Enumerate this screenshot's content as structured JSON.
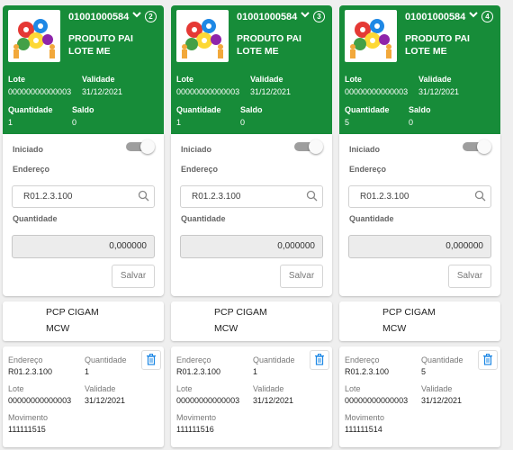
{
  "labels": {
    "lote": "Lote",
    "validade": "Validade",
    "quantidade": "Quantidade",
    "saldo": "Saldo",
    "iniciado": "Iniciado",
    "endereco": "Endereço",
    "movimento": "Movimento",
    "save": "Salvar"
  },
  "colors": {
    "header_green": "#178c39",
    "toggle_off": "#9e9e9e"
  },
  "icons": {
    "expand": "chevron-down-icon",
    "search": "search-icon",
    "delete": "trash-icon"
  },
  "cards": [
    {
      "code": "01001000584",
      "badge": "2",
      "product": "PRODUTO PAI LOTE ME",
      "lote": "00000000000003",
      "validade": "31/12/2021",
      "quantidade": "1",
      "saldo": "0",
      "iniciado": false,
      "endereco": "R01.2.3.100",
      "quantidade_input": "0,000000",
      "company": "PCP CIGAM",
      "company_sub": "MCW",
      "mov": {
        "endereco": "R01.2.3.100",
        "quantidade": "1",
        "lote": "00000000000003",
        "validade": "31/12/2021",
        "movimento": "111111515"
      }
    },
    {
      "code": "01001000584",
      "badge": "3",
      "product": "PRODUTO PAI LOTE ME",
      "lote": "00000000000003",
      "validade": "31/12/2021",
      "quantidade": "1",
      "saldo": "0",
      "iniciado": false,
      "endereco": "R01.2.3.100",
      "quantidade_input": "0,000000",
      "company": "PCP CIGAM",
      "company_sub": "MCW",
      "mov": {
        "endereco": "R01.2.3.100",
        "quantidade": "1",
        "lote": "00000000000003",
        "validade": "31/12/2021",
        "movimento": "111111516"
      }
    },
    {
      "code": "01001000584",
      "badge": "4",
      "product": "PRODUTO PAI LOTE ME",
      "lote": "00000000000003",
      "validade": "31/12/2021",
      "quantidade": "5",
      "saldo": "0",
      "iniciado": false,
      "endereco": "R01.2.3.100",
      "quantidade_input": "0,000000",
      "company": "PCP CIGAM",
      "company_sub": "MCW",
      "mov": {
        "endereco": "R01.2.3.100",
        "quantidade": "5",
        "lote": "00000000000003",
        "validade": "31/12/2021",
        "movimento": "111111514"
      }
    }
  ]
}
